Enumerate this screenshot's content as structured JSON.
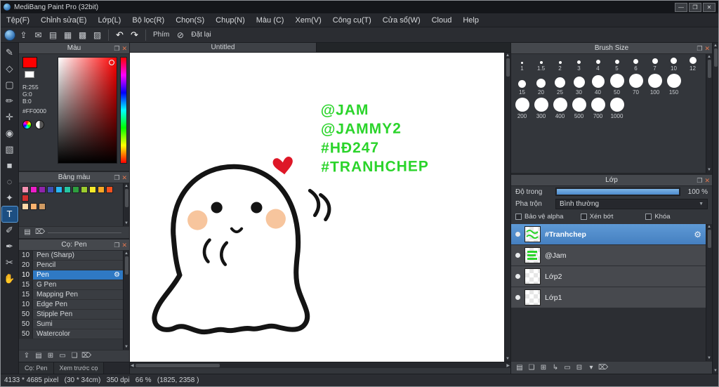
{
  "window": {
    "title": "MediBang Paint Pro (32bit)",
    "controls": {
      "minimize": "—",
      "maximize": "❐",
      "close": "✕"
    }
  },
  "menu": {
    "items": [
      "Tệp(F)",
      "Chỉnh sửa(E)",
      "Lớp(L)",
      "Bộ lọc(R)",
      "Chọn(S)",
      "Chụp(N)",
      "Màu (C)",
      "Xem(V)",
      "Công cụ(T)",
      "Cửa sổ(W)",
      "Cloud",
      "Help"
    ]
  },
  "toolbar": {
    "icons": [
      {
        "name": "upload-icon",
        "glyph": "⇪"
      },
      {
        "name": "message-icon",
        "glyph": "✉"
      },
      {
        "name": "document-icon",
        "glyph": "▤"
      },
      {
        "name": "panel-layout-icon",
        "glyph": "▦"
      },
      {
        "name": "grid-icon",
        "glyph": "▩"
      },
      {
        "name": "snap-grid-icon",
        "glyph": "▨"
      }
    ],
    "undo_glyph": "↶",
    "redo_glyph": "↷",
    "phim_label": "Phím",
    "slash_icon": "⊘",
    "reset_label": "Đặt lại"
  },
  "tools": [
    {
      "name": "brush-tool",
      "glyph": "✎"
    },
    {
      "name": "eraser-tool",
      "glyph": "◇"
    },
    {
      "name": "marquee-select-tool",
      "glyph": "▢"
    },
    {
      "name": "smudge-tool",
      "glyph": "✏"
    },
    {
      "name": "move-tool",
      "glyph": "✛"
    },
    {
      "name": "fill-bucket-tool",
      "glyph": "◉"
    },
    {
      "name": "gradient-tool",
      "glyph": "▧"
    },
    {
      "name": "shape-tool",
      "glyph": "■"
    },
    {
      "name": "lasso-tool",
      "glyph": "◌"
    },
    {
      "name": "magic-wand-tool",
      "glyph": "✦"
    },
    {
      "name": "text-tool",
      "glyph": "T",
      "selected": true
    },
    {
      "name": "select-pen-tool",
      "glyph": "✐"
    },
    {
      "name": "eyedropper-tool",
      "glyph": "✒"
    },
    {
      "name": "divide-tool",
      "glyph": "✂"
    },
    {
      "name": "hand-tool",
      "glyph": "✋"
    }
  ],
  "ui": {
    "popout_icon": "❐",
    "close_icon": "✕",
    "gear_icon": "⚙",
    "up_arrow": "▲",
    "down_arrow": "▼",
    "left_arrow": "◀",
    "right_arrow": "▶"
  },
  "panels": {
    "color": {
      "title": "Màu",
      "fg_color": "#ff0000",
      "r": "R:255",
      "g": "G:0",
      "b": "B:0",
      "hex": "#FF0000"
    },
    "palette": {
      "title": "Bảng màu",
      "row1": [
        "#f48fb1",
        "#ec1ec9",
        "#8e24aa",
        "#3f51b5",
        "#29b6f6",
        "#26c6a2",
        "#2e9e3f",
        "#9ccc2e",
        "#f7e92a",
        "#f9a825",
        "#f4511e",
        "#d32f2f"
      ],
      "row2": [
        "#ffd9a8",
        "#f9b16e",
        "#cf9a62"
      ],
      "footer_icons": [
        {
          "name": "new-palette-icon",
          "glyph": "▤"
        },
        {
          "name": "delete-palette-icon",
          "glyph": "⌦"
        }
      ]
    },
    "brush": {
      "title": "Cọ: Pen",
      "brushes": [
        {
          "size": "10",
          "name": "Pen (Sharp)"
        },
        {
          "size": "20",
          "name": "Pencil"
        },
        {
          "size": "10",
          "name": "Pen",
          "selected": true
        },
        {
          "size": "15",
          "name": "G Pen"
        },
        {
          "size": "15",
          "name": "Mapping Pen"
        },
        {
          "size": "10",
          "name": "Edge Pen"
        },
        {
          "size": "50",
          "name": "Stipple Pen"
        },
        {
          "size": "50",
          "name": "Sumi"
        },
        {
          "size": "50",
          "name": "Watercolor"
        }
      ],
      "footer_icons": [
        {
          "name": "sync-brush-icon",
          "glyph": "⇪"
        },
        {
          "name": "new-brush-icon",
          "glyph": "▤"
        },
        {
          "name": "add-brush-icon",
          "glyph": "⊞"
        },
        {
          "name": "brush-folder-icon",
          "glyph": "▭"
        },
        {
          "name": "duplicate-brush-icon",
          "glyph": "❏"
        },
        {
          "name": "delete-brush-icon",
          "glyph": "⌦"
        }
      ],
      "tabs": [
        {
          "name": "tab-brush",
          "label": "Cọ: Pen",
          "selected": true
        },
        {
          "name": "tab-brush-preview",
          "label": "Xem trước cọ"
        }
      ]
    },
    "brush_size": {
      "title": "Brush Size",
      "rows": [
        [
          "1",
          "1.5",
          "2",
          "3",
          "4",
          "5",
          "6",
          "7",
          "10",
          "12"
        ],
        [
          "15",
          "20",
          "25",
          "30",
          "40",
          "50",
          "70",
          "100",
          "150"
        ],
        [
          "200",
          "300",
          "400",
          "500",
          "700",
          "1000"
        ]
      ]
    },
    "layer": {
      "title": "Lớp",
      "opacity_label": "Độ trong",
      "opacity_value": "100 %",
      "blend_label": "Pha trộn",
      "blend_value": "Bình thường",
      "checkboxes": [
        "Bảo vệ alpha",
        "Xén bớt",
        "Khóa"
      ],
      "layers": [
        {
          "name": "#Tranhchep",
          "selected": true
        },
        {
          "name": "@Jam"
        },
        {
          "name": "Lớp2"
        },
        {
          "name": "Lớp1"
        }
      ],
      "footer_icons": [
        {
          "name": "new-layer-icon",
          "glyph": "▤"
        },
        {
          "name": "duplicate-layer-icon",
          "glyph": "❏"
        },
        {
          "name": "copy-layer-icon",
          "glyph": "⊞"
        },
        {
          "name": "transfer-layer-icon",
          "glyph": "↳"
        },
        {
          "name": "layer-folder-icon",
          "glyph": "▭"
        },
        {
          "name": "merge-layer-icon",
          "glyph": "⊟"
        },
        {
          "name": "layer-menu-icon",
          "glyph": "▾"
        },
        {
          "name": "delete-layer-icon",
          "glyph": "⌦"
        }
      ]
    }
  },
  "canvas": {
    "tab": "Untitled",
    "annotations": [
      "@JAM",
      "@JAMMY2",
      "#HĐ247",
      "#TRANHCHEP"
    ],
    "text_color": "#2bd42b",
    "heart_color": "#de1727",
    "blush_color": "#f7c59d",
    "outline_color": "#141414"
  },
  "status": {
    "text": "4133 * 4685 pixel   (30 * 34cm)   350 dpi   66 %   (1825, 2358 )"
  }
}
